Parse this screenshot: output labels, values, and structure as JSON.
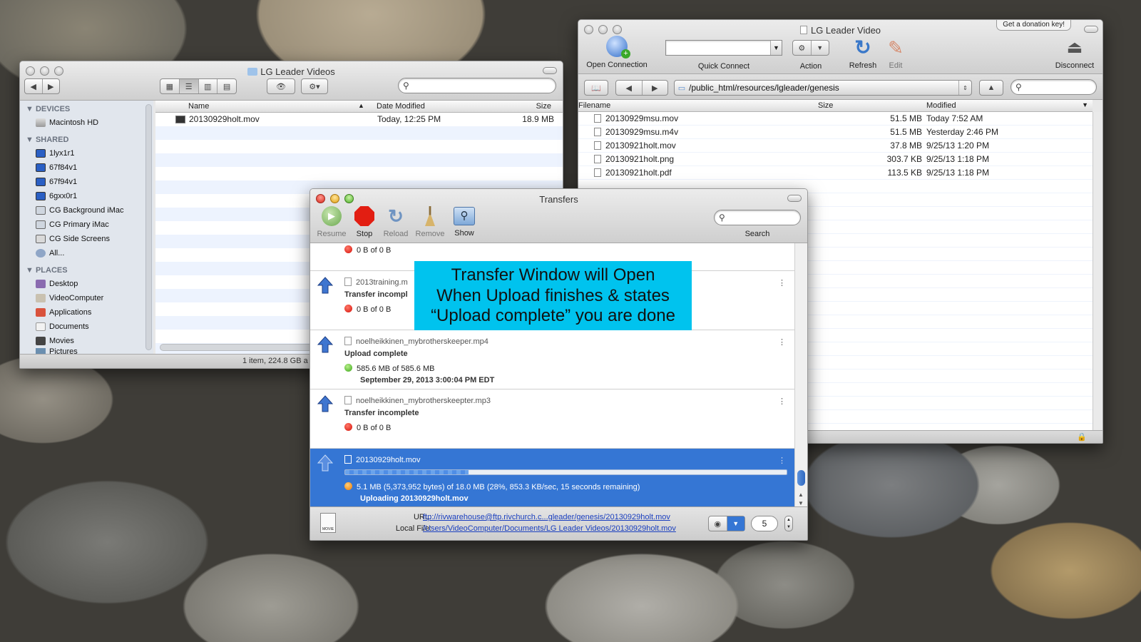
{
  "finder": {
    "title": "LG Leader Videos",
    "sidebar": {
      "devices_header": "DEVICES",
      "devices": [
        "Macintosh HD"
      ],
      "shared_header": "SHARED",
      "shared": [
        "1lyx1r1",
        "67f84v1",
        "67f94v1",
        "6gxx0r1",
        "CG Background iMac",
        "CG Primary iMac",
        "CG Side Screens",
        "All..."
      ],
      "places_header": "PLACES",
      "places": [
        "Desktop",
        "VideoComputer",
        "Applications",
        "Documents",
        "Movies",
        "Pictures"
      ]
    },
    "columns": {
      "name": "Name",
      "date": "Date Modified",
      "size": "Size"
    },
    "files": [
      {
        "name": "20130929holt.mov",
        "date": "Today, 12:25 PM",
        "size": "18.9 MB"
      }
    ],
    "status": "1 item, 224.8 GB a"
  },
  "ftp": {
    "title": "LG Leader Video",
    "donation": "Get a donation key!",
    "toolbar": {
      "open_connection": "Open Connection",
      "quick_connect": "Quick Connect",
      "action": "Action",
      "refresh": "Refresh",
      "edit": "Edit",
      "disconnect": "Disconnect"
    },
    "path": "/public_html/resources/lgleader/genesis",
    "columns": {
      "filename": "Filename",
      "size": "Size",
      "modified": "Modified"
    },
    "files": [
      {
        "name": "20130929msu.mov",
        "size": "51.5 MB",
        "modified": "Today 7:52 AM"
      },
      {
        "name": "20130929msu.m4v",
        "size": "51.5 MB",
        "modified": "Yesterday 2:46 PM"
      },
      {
        "name": "20130921holt.mov",
        "size": "37.8 MB",
        "modified": "9/25/13 1:20 PM"
      },
      {
        "name": "20130921holt.png",
        "size": "303.7 KB",
        "modified": "9/25/13 1:18 PM"
      },
      {
        "name": "20130921holt.pdf",
        "size": "113.5 KB",
        "modified": "9/25/13 1:18 PM"
      }
    ]
  },
  "transfers": {
    "title": "Transfers",
    "toolbar": {
      "resume": "Resume",
      "stop": "Stop",
      "reload": "Reload",
      "remove": "Remove",
      "show": "Show",
      "search": "Search"
    },
    "items": [
      {
        "status": "0 B of 0 B"
      },
      {
        "file": "2013training.m",
        "line": "Transfer incompl",
        "status": "0 B of 0 B"
      },
      {
        "file": "noelheikkinen_mybrotherskeeper.mp4",
        "line": "Upload complete",
        "status": "585.6 MB of 585.6 MB",
        "date": "September 29, 2013 3:00:04 PM EDT"
      },
      {
        "file": "noelheikkinen_mybrotherskeepter.mp3",
        "line": "Transfer incomplete",
        "status": "0 B of 0 B"
      },
      {
        "file": "20130929holt.mov",
        "status": "5.1 MB (5,373,952 bytes) of 18.0 MB (28%, 853.3 KB/sec, 15 seconds remaining)",
        "line": "Uploading 20130929holt.mov",
        "progress": 0.28
      }
    ],
    "url_label": "URL:",
    "url": "ftp://rivwarehouse@ftp.rivchurch.c...gleader/genesis/20130929holt.mov",
    "local_label": "Local File:",
    "local": "/Users/VideoComputer/Documents/LG Leader Videos/20130929holt.mov",
    "connections": "5",
    "movie_icon": "MOVIE"
  },
  "annotation": {
    "line1": "Transfer Window will Open",
    "line2": "When Upload finishes & states",
    "line3": "“Upload complete” you are done"
  }
}
